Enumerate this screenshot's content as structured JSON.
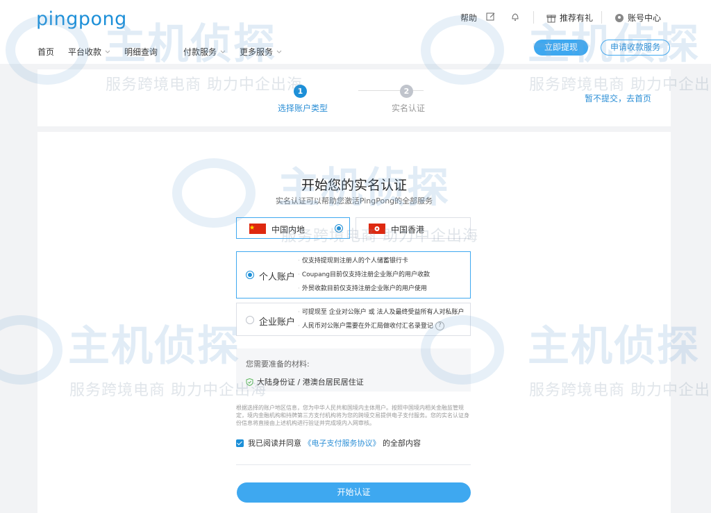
{
  "header": {
    "logo": "pingpong",
    "help": "帮助",
    "recommend": "推荐有礼",
    "account_center": "账号中心",
    "nav": [
      {
        "label": "首页",
        "has_menu": false
      },
      {
        "label": "平台收款",
        "has_menu": true
      },
      {
        "label": "明细查询",
        "has_menu": false
      },
      {
        "label": "付款服务",
        "has_menu": true
      },
      {
        "label": "更多服务",
        "has_menu": true
      }
    ],
    "withdraw_button": "立即提现",
    "apply_button": "申请收款服务"
  },
  "steps": {
    "items": [
      {
        "num": "1",
        "label": "选择账户类型",
        "active": true
      },
      {
        "num": "2",
        "label": "实名认证",
        "active": false
      }
    ],
    "skip_link": "暂不提交，去首页"
  },
  "main": {
    "title": "开始您的实名认证",
    "subtitle": "实名认证可以帮助您激活PingPong的全部服务",
    "regions": [
      {
        "label": "中国内地",
        "selected": true
      },
      {
        "label": "中国香港",
        "selected": false
      }
    ],
    "personal": {
      "label": "个人账户",
      "selected": true,
      "lines": [
        "仅支持提现到注册人的个人储蓄银行卡",
        "Coupang目前仅支持注册企业账户的用户收款",
        "外贸收款目前仅支持注册企业账户的用户使用"
      ]
    },
    "enterprise": {
      "label": "企业账户",
      "selected": false,
      "lines": [
        "可提现至 企业对公账户 或 法人及最终受益所有人对私账户",
        "人民币对公账户需要在外汇局做收付汇名录登记"
      ]
    },
    "materials": {
      "title": "您需要准备的材料:",
      "item": "大陆身份证 / 港澳台居民居住证"
    },
    "notice": "根据选择的账户地区信息，您为中华人民共和国境内主体用户。按照中国境内相关金融监管规定，境内金融机构和持牌第三方支付机构将为您的跨境交易提供电子支付服务。您的实名认证身份信息将直接由上述机构进行验证并完成境内入网审核。",
    "agree": {
      "prefix": "我已阅读并同意",
      "link": "《电子支付服务协议》",
      "suffix": "的全部内容"
    },
    "start_button": "开始认证"
  },
  "watermark": {
    "big": "主机侦探",
    "small": "服务跨境电商 助力中企出海"
  },
  "colors": {
    "brand": "#1c8fd8",
    "button": "#3ea8f0",
    "background": "#f2f3f5"
  }
}
